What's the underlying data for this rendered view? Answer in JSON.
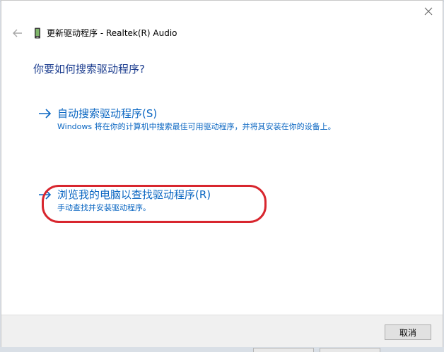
{
  "window": {
    "title": "更新驱动程序 - Realtek(R) Audio"
  },
  "icons": {
    "close": "close-icon",
    "back": "back-arrow-icon",
    "device": "device-icon",
    "option_arrow": "arrow-right-icon"
  },
  "main": {
    "question": "你要如何搜索驱动程序?",
    "options": [
      {
        "title": "自动搜索驱动程序(S)",
        "description": "Windows 将在你的计算机中搜索最佳可用驱动程序，并将其安装在你的设备上。"
      },
      {
        "title": "浏览我的电脑以查找驱动程序(R)",
        "description": "手动查找并安装驱动程序。"
      }
    ]
  },
  "footer": {
    "cancel_label": "取消"
  },
  "colors": {
    "link": "#0a66c2",
    "question": "#1c3d8f",
    "highlight": "#d8262e"
  }
}
